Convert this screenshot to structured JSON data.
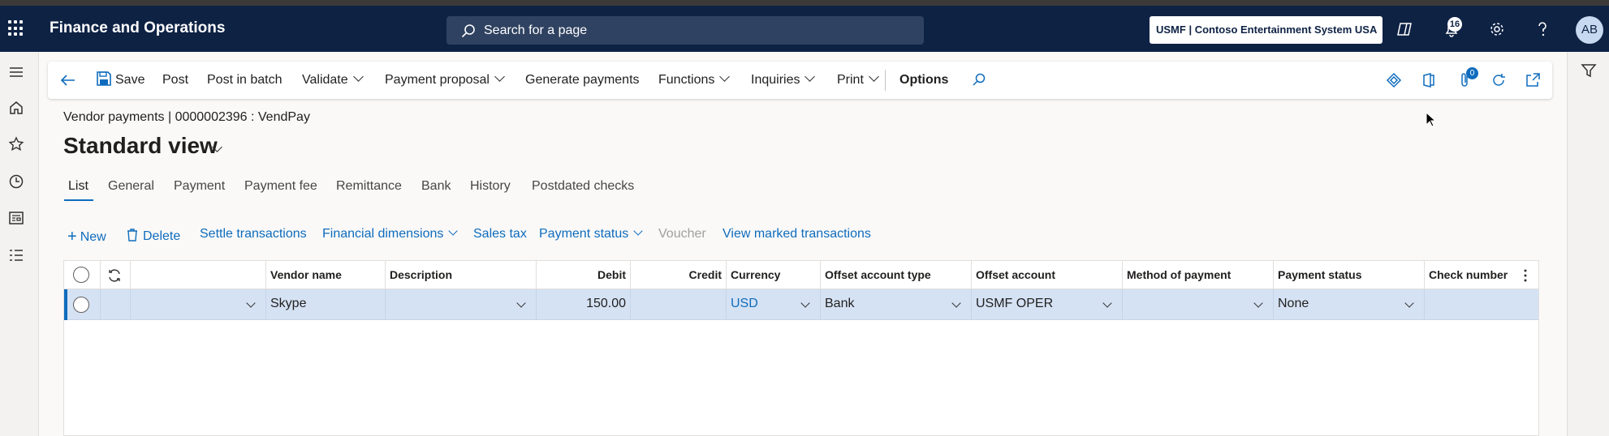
{
  "app": {
    "title": "Finance and Operations"
  },
  "search": {
    "placeholder": "Search for a page"
  },
  "company": {
    "label": "USMF | Contoso Entertainment System USA"
  },
  "notifications": {
    "count": "16"
  },
  "user": {
    "initials": "AB"
  },
  "action_pane": {
    "save": "Save",
    "post": "Post",
    "post_in_batch": "Post in batch",
    "validate": "Validate",
    "payment_proposal": "Payment proposal",
    "generate_payments": "Generate payments",
    "functions": "Functions",
    "inquiries": "Inquiries",
    "print": "Print",
    "options": "Options",
    "attachments_count": "0"
  },
  "breadcrumb": "Vendor payments  |  0000002396 : VendPay",
  "view": {
    "title": "Standard view"
  },
  "tabs": [
    {
      "label": "List"
    },
    {
      "label": "General"
    },
    {
      "label": "Payment"
    },
    {
      "label": "Payment fee"
    },
    {
      "label": "Remittance"
    },
    {
      "label": "Bank"
    },
    {
      "label": "History"
    },
    {
      "label": "Postdated checks"
    }
  ],
  "lines_toolbar": {
    "new": "New",
    "delete": "Delete",
    "settle": "Settle transactions",
    "financial_dimensions": "Financial dimensions",
    "sales_tax": "Sales tax",
    "payment_status": "Payment status",
    "voucher": "Voucher",
    "view_marked": "View marked transactions"
  },
  "grid": {
    "columns": [
      "",
      "Vendor name",
      "Description",
      "Debit",
      "Credit",
      "Currency",
      "Offset account type",
      "Offset account",
      "Method of payment",
      "Payment status",
      "Check number"
    ],
    "rows": [
      {
        "account": "",
        "vendor_name": "Skype",
        "description": "",
        "debit": "150.00",
        "credit": "",
        "currency": "USD",
        "offset_account_type": "Bank",
        "offset_account": "USMF OPER",
        "method_of_payment": "",
        "payment_status": "None",
        "check_number": ""
      }
    ]
  },
  "colors": {
    "nav_bar": "#0e2244",
    "accent": "#0f6cbd",
    "selected_row": "#d5e2f4"
  }
}
